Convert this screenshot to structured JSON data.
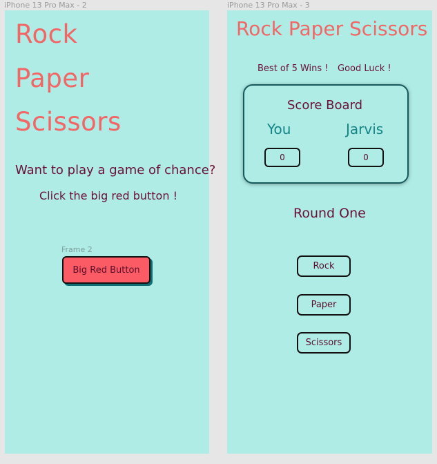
{
  "frames": [
    {
      "label": "iPhone 13 Pro Max - 2"
    },
    {
      "label": "iPhone 13 Pro Max - 3"
    }
  ],
  "screen1": {
    "title_lines": [
      "Rock",
      "Paper",
      "Scissors"
    ],
    "question": "Want to play a game of chance?",
    "instruction": "Click the big red button !",
    "inner_frame_label": "Frame 2",
    "button_label": "Big Red Button"
  },
  "screen2": {
    "title": "Rock Paper Scissors",
    "subtitle_left": "Best of 5 Wins !",
    "subtitle_right": "Good Luck !",
    "scoreboard": {
      "title": "Score Board",
      "player_label": "You",
      "opponent_label": "Jarvis",
      "player_score": "0",
      "opponent_score": "0"
    },
    "round_label": "Round One",
    "choices": [
      "Rock",
      "Paper",
      "Scissors"
    ]
  },
  "colors": {
    "canvas": "#e6e6e6",
    "screen_bg": "#afece6",
    "title_coral": "#f26666",
    "text_maroon": "#6b0f37",
    "label_teal": "#138486",
    "button_red": "#fb5b64"
  }
}
